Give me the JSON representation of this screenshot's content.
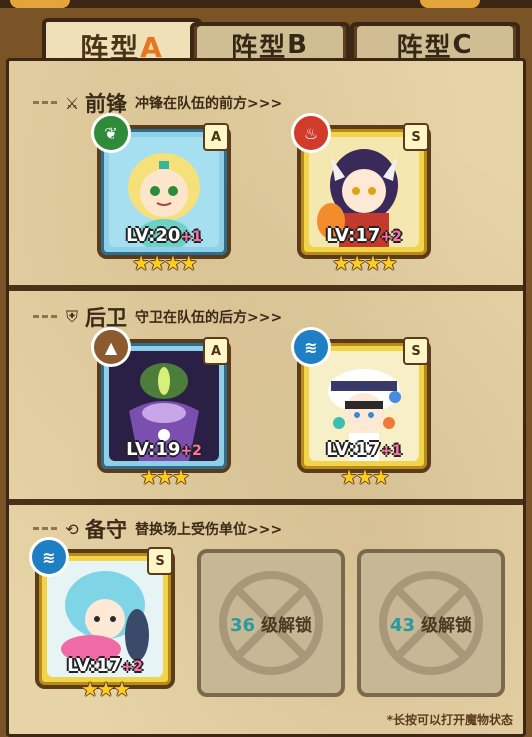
{
  "tabs": [
    {
      "label": "阵型",
      "letter": "A",
      "active": true
    },
    {
      "label": "阵型",
      "letter": "B",
      "active": false
    },
    {
      "label": "阵型",
      "letter": "C",
      "active": false
    }
  ],
  "sections": {
    "front": {
      "name": "前锋",
      "desc": "冲锋在队伍的前方>>>"
    },
    "back": {
      "name": "后卫",
      "desc": "守卫在队伍的后方>>>"
    },
    "reserve": {
      "name": "备守",
      "desc": "替换场上受伤单位>>>"
    }
  },
  "cards": [
    {
      "id": "front-1",
      "element": "leaf",
      "element_color": "#2f8a3a",
      "rarity": "A",
      "level": "LV:20",
      "plus": "+1",
      "stars": "★★★★",
      "border": "blue"
    },
    {
      "id": "front-2",
      "element": "fire",
      "element_color": "#d23b2a",
      "rarity": "S",
      "level": "LV:17",
      "plus": "+2",
      "stars": "★★★★",
      "border": "gold"
    },
    {
      "id": "back-1",
      "element": "earth",
      "element_color": "#8b5a2e",
      "rarity": "A",
      "level": "LV:19",
      "plus": "+2",
      "stars": "★★★",
      "border": "blue"
    },
    {
      "id": "back-2",
      "element": "water",
      "element_color": "#1e7fc4",
      "rarity": "S",
      "level": "LV:17",
      "plus": "+1",
      "stars": "★★★",
      "border": "gold"
    },
    {
      "id": "reserve-1",
      "element": "water",
      "element_color": "#1e7fc4",
      "rarity": "S",
      "level": "LV:17",
      "plus": "+2",
      "stars": "★★★",
      "border": "gold"
    }
  ],
  "locked_slots": [
    {
      "level": "36",
      "label": "级解锁"
    },
    {
      "level": "43",
      "label": "级解锁"
    }
  ],
  "footnote": "*长按可以打开魔物状态"
}
